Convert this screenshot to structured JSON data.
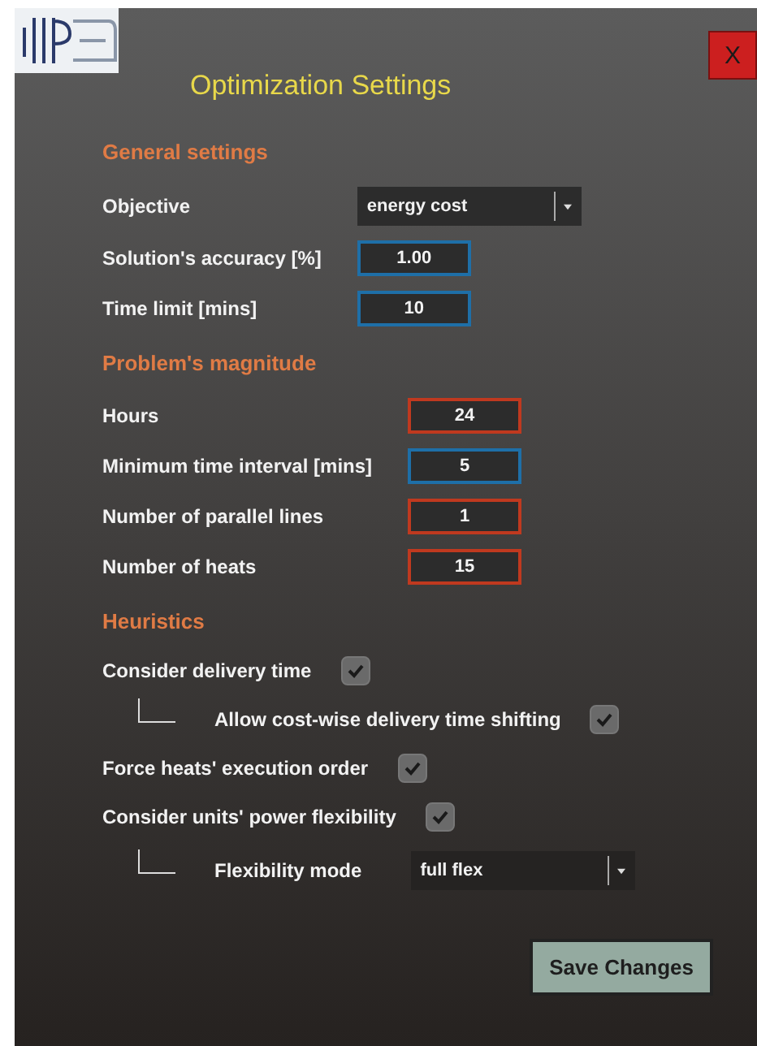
{
  "window": {
    "title": "Optimization Settings",
    "close": "X"
  },
  "sections": [
    {
      "title": "General settings",
      "rows": [
        {
          "kind": "select",
          "label": "Objective",
          "value": "energy cost"
        },
        {
          "kind": "field",
          "label": "Solution's accuracy [%]",
          "value": "1.00",
          "color": "#1e6fa8"
        },
        {
          "kind": "field",
          "label": "Time limit [mins]",
          "value": "10",
          "color": "#1e6fa8"
        }
      ]
    },
    {
      "title": "Problem's magnitude",
      "rows": [
        {
          "kind": "field",
          "label": "Hours",
          "value": "24",
          "color": "#c0391f"
        },
        {
          "kind": "field",
          "label": "Minimum time interval [mins]",
          "value": "5",
          "color": "#1e6fa8"
        },
        {
          "kind": "field",
          "label": "Number of parallel lines",
          "value": "1",
          "color": "#c0391f"
        },
        {
          "kind": "field",
          "label": "Number of heats",
          "value": "15",
          "color": "#c0391f"
        }
      ]
    },
    {
      "title": "Heuristics",
      "rows": [
        {
          "kind": "checkbox",
          "label": "Consider delivery time",
          "checked": true,
          "children": [
            {
              "kind": "checkbox",
              "label": "Allow cost-wise delivery time shifting",
              "checked": true
            }
          ]
        },
        {
          "kind": "checkbox",
          "label": "Force heats' execution order",
          "checked": true
        },
        {
          "kind": "checkbox",
          "label": "Consider units' power flexibility",
          "checked": true,
          "children": [
            {
              "kind": "select",
              "label": "Flexibility mode",
              "value": "full flex"
            }
          ]
        }
      ]
    }
  ],
  "save_button": "Save Changes"
}
